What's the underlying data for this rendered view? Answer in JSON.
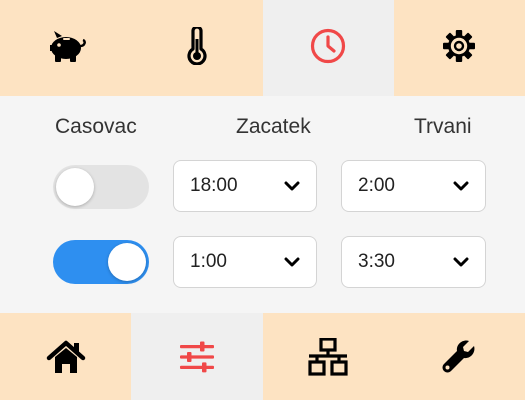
{
  "top_tabs": [
    {
      "icon": "piggy-bank-icon",
      "active": false
    },
    {
      "icon": "thermometer-icon",
      "active": false
    },
    {
      "icon": "clock-icon",
      "active": true
    },
    {
      "icon": "gear-icon",
      "active": false
    }
  ],
  "headers": {
    "timer": "Casovac",
    "start": "Zacatek",
    "duration": "Trvani"
  },
  "rows": [
    {
      "enabled": false,
      "start": "18:00",
      "duration": "2:00"
    },
    {
      "enabled": true,
      "start": "1:00",
      "duration": "3:30"
    }
  ],
  "bottom_tabs": [
    {
      "icon": "home-icon",
      "active": false
    },
    {
      "icon": "sliders-icon",
      "active": true
    },
    {
      "icon": "network-icon",
      "active": false
    },
    {
      "icon": "wrench-icon",
      "active": false
    }
  ],
  "colors": {
    "bar_bg": "#fde3c2",
    "active_tab_bg": "#efefef",
    "accent_red": "#f04848",
    "toggle_on": "#2e8ff0",
    "toggle_off": "#e3e3e3"
  }
}
